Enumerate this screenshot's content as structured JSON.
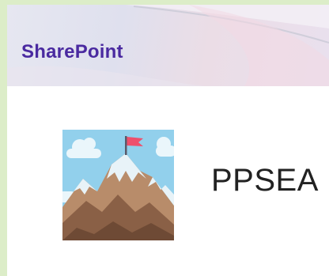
{
  "header": {
    "brand": "SharePoint"
  },
  "site": {
    "title": "PPSEA",
    "logo_icon": "mountain-flag-icon"
  },
  "colors": {
    "outer_background": "#dcedc8",
    "brand_text": "#4a2aa0",
    "title_text": "#222222",
    "sky": "#92d0ec"
  }
}
